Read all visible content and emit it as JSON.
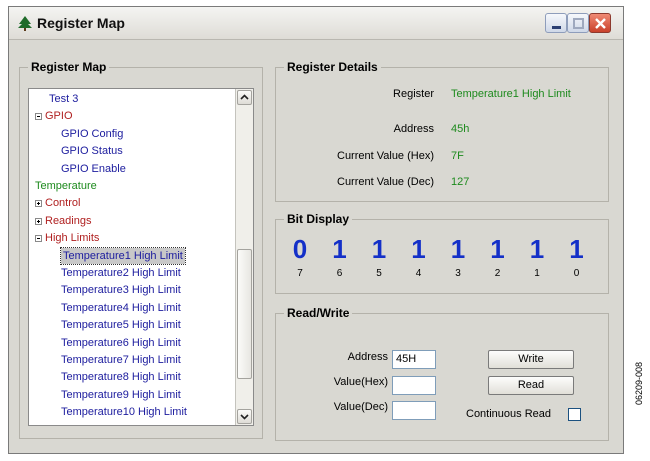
{
  "window": {
    "title": "Register Map"
  },
  "map_panel": {
    "title": "Register Map",
    "tree": [
      {
        "label": "Test 3",
        "kind": "leaf",
        "color": "#1c1c9e"
      },
      {
        "label": "GPIO",
        "kind": "expanded",
        "color": "#b02020"
      },
      {
        "label": "GPIO Config",
        "kind": "leaf",
        "color": "#1c1c9e"
      },
      {
        "label": "GPIO Status",
        "kind": "leaf",
        "color": "#1c1c9e"
      },
      {
        "label": "GPIO Enable",
        "kind": "leaf",
        "color": "#1c1c9e"
      },
      {
        "label": "Temperature",
        "kind": "root",
        "color": "#1d8a1d"
      },
      {
        "label": "Control",
        "kind": "collapsed",
        "color": "#b02020"
      },
      {
        "label": "Readings",
        "kind": "collapsed",
        "color": "#b02020"
      },
      {
        "label": "High Limits",
        "kind": "expanded",
        "color": "#b02020"
      },
      {
        "label": "Temperature1 High Limit",
        "kind": "leaf",
        "color": "#1c1c9e",
        "selected": true
      },
      {
        "label": "Temperature2 High Limit",
        "kind": "leaf",
        "color": "#1c1c9e"
      },
      {
        "label": "Temperature3 High Limit",
        "kind": "leaf",
        "color": "#1c1c9e"
      },
      {
        "label": "Temperature4 High Limit",
        "kind": "leaf",
        "color": "#1c1c9e"
      },
      {
        "label": "Temperature5 High Limit",
        "kind": "leaf",
        "color": "#1c1c9e"
      },
      {
        "label": "Temperature6 High Limit",
        "kind": "leaf",
        "color": "#1c1c9e"
      },
      {
        "label": "Temperature7 High Limit",
        "kind": "leaf",
        "color": "#1c1c9e"
      },
      {
        "label": "Temperature8 High Limit",
        "kind": "leaf",
        "color": "#1c1c9e"
      },
      {
        "label": "Temperature9 High Limit",
        "kind": "leaf",
        "color": "#1c1c9e"
      },
      {
        "label": "Temperature10 High Limit",
        "kind": "leaf",
        "color": "#1c1c9e"
      }
    ]
  },
  "details": {
    "title": "Register Details",
    "rows": [
      {
        "label": "Register",
        "value": "Temperature1 High Limit"
      },
      {
        "label": "Address",
        "value": "45h"
      },
      {
        "label": "Current Value (Hex)",
        "value": "7F"
      },
      {
        "label": "Current Value (Dec)",
        "value": "127"
      }
    ]
  },
  "bits": {
    "title": "Bit Display",
    "values": [
      "0",
      "1",
      "1",
      "1",
      "1",
      "1",
      "1",
      "1"
    ],
    "indices": [
      "7",
      "6",
      "5",
      "4",
      "3",
      "2",
      "1",
      "0"
    ]
  },
  "rw": {
    "title": "Read/Write",
    "address_label": "Address",
    "address_value": "45H",
    "hex_label": "Value(Hex)",
    "hex_value": "",
    "dec_label": "Value(Dec)",
    "dec_value": "",
    "write_label": "Write",
    "read_label": "Read",
    "continuous_label": "Continuous Read",
    "continuous_checked": false
  },
  "figure_code": "06209-008",
  "colors": {
    "bit_blue": "#1430c8",
    "value_green": "#1d8a1d",
    "tree_red": "#b02020",
    "tree_blue": "#1c1c9e"
  }
}
